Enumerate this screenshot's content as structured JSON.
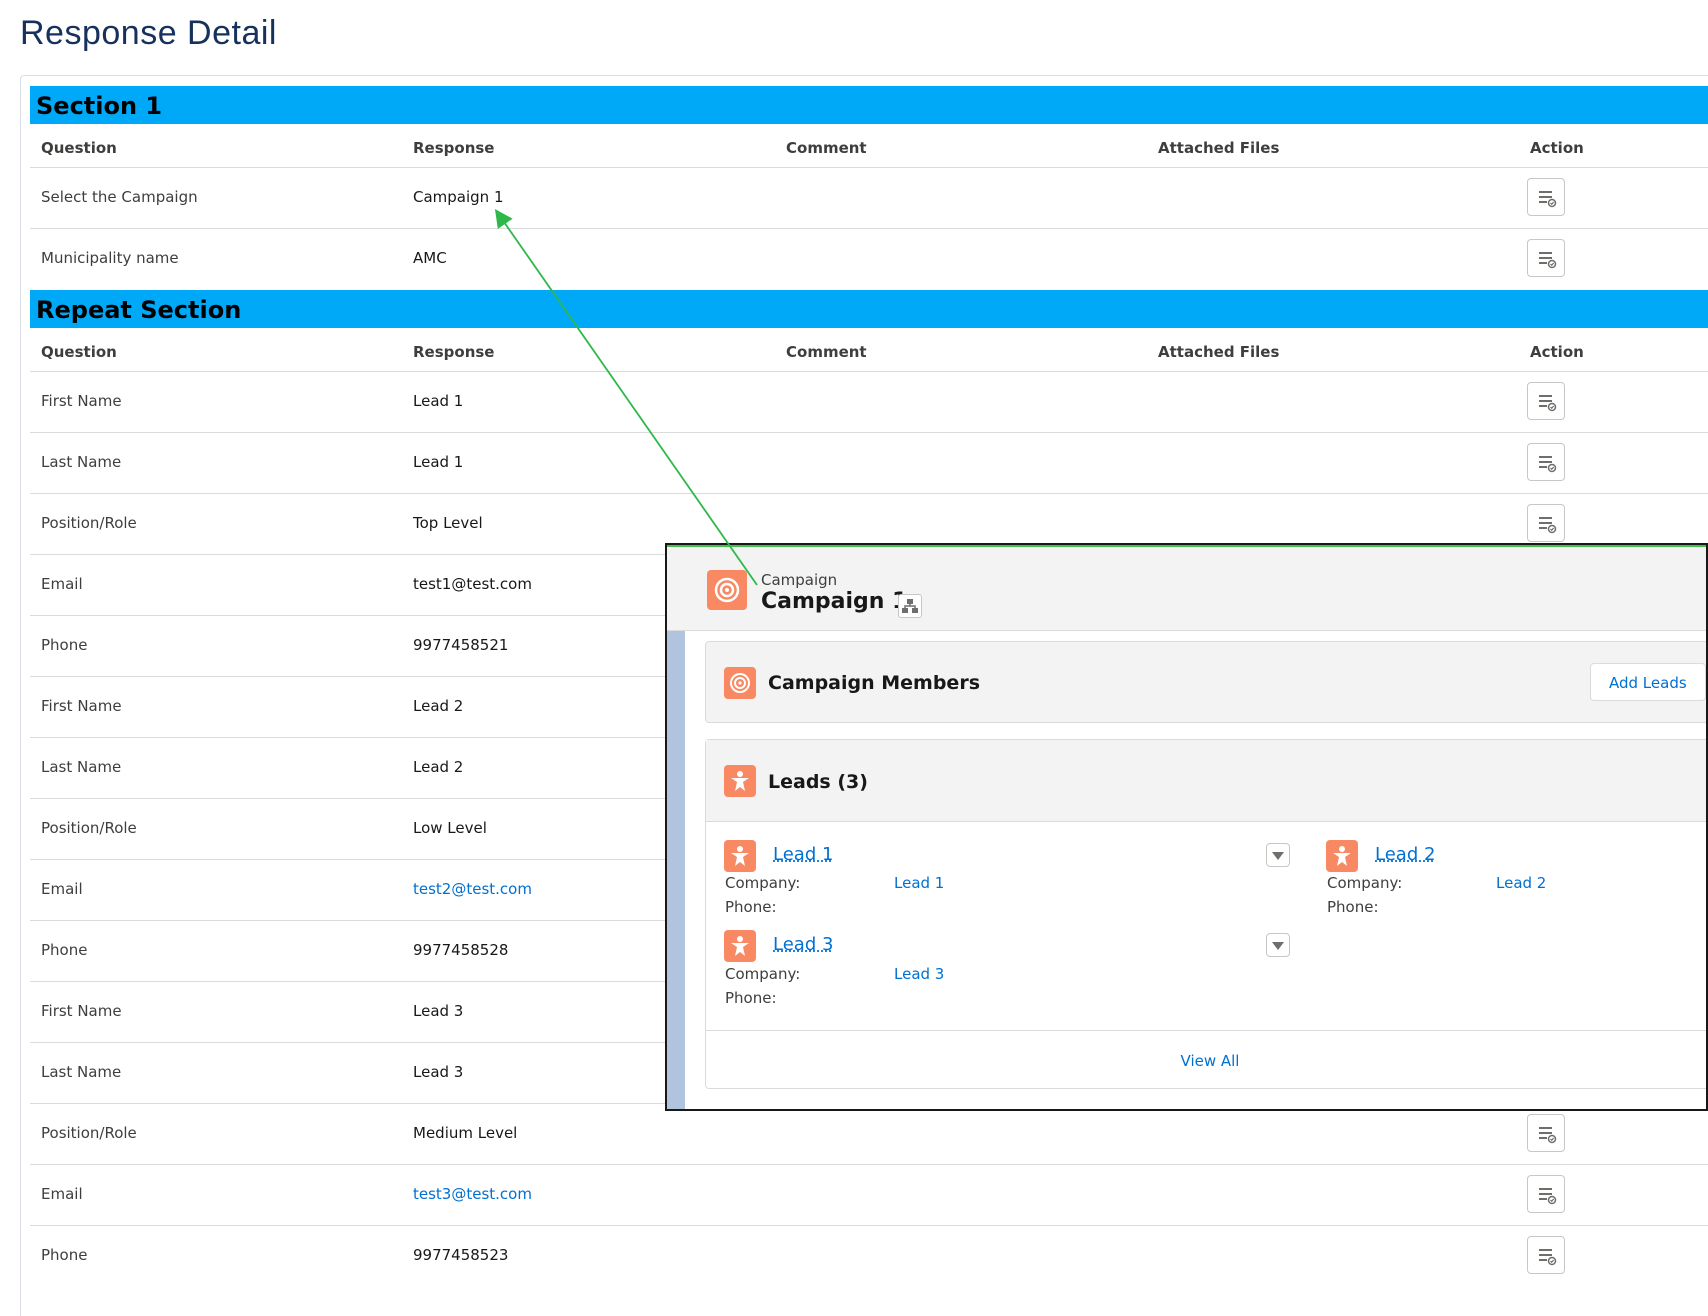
{
  "page": {
    "title": "Response Detail"
  },
  "columns": {
    "question": "Question",
    "response": "Response",
    "comment": "Comment",
    "files": "Attached Files",
    "action": "Action"
  },
  "section1": {
    "title": "Section 1",
    "rows": [
      {
        "question": "Select the Campaign",
        "response": "Campaign 1"
      },
      {
        "question": "Municipality name",
        "response": "AMC"
      }
    ]
  },
  "repeat": {
    "title": "Repeat Section",
    "rows": [
      {
        "question": "First Name",
        "response": "Lead 1"
      },
      {
        "question": "Last Name",
        "response": "Lead 1"
      },
      {
        "question": "Position/Role",
        "response": "Top Level"
      },
      {
        "question": "Email",
        "response": "test1@test.com"
      },
      {
        "question": "Phone",
        "response": "9977458521"
      },
      {
        "question": "First Name",
        "response": "Lead 2"
      },
      {
        "question": "Last Name",
        "response": "Lead 2"
      },
      {
        "question": "Position/Role",
        "response": "Low Level"
      },
      {
        "question": "Email",
        "response": "test2@test.com"
      },
      {
        "question": "Phone",
        "response": "9977458528"
      },
      {
        "question": "First Name",
        "response": "Lead 3"
      },
      {
        "question": "Last Name",
        "response": "Lead 3"
      },
      {
        "question": "Position/Role",
        "response": "Medium Level"
      },
      {
        "question": "Email",
        "response": "test3@test.com"
      },
      {
        "question": "Phone",
        "response": "9977458523"
      }
    ]
  },
  "popup": {
    "object_type": "Campaign",
    "record_name": "Campaign 1",
    "members_card": {
      "title": "Campaign Members",
      "add_button": "Add Leads"
    },
    "leads_card": {
      "title": "Leads (3)",
      "company_label": "Company:",
      "phone_label": "Phone:",
      "leads": [
        {
          "name": "Lead 1",
          "company": "Lead 1"
        },
        {
          "name": "Lead 2",
          "company": "Lead 2"
        },
        {
          "name": "Lead 3",
          "company": "Lead 3"
        }
      ],
      "view_all": "View All"
    }
  },
  "colors": {
    "section_header": "#00a9f8",
    "link": "#0070d2",
    "arrow": "#2eb84a",
    "object_icon": "#f88962"
  }
}
